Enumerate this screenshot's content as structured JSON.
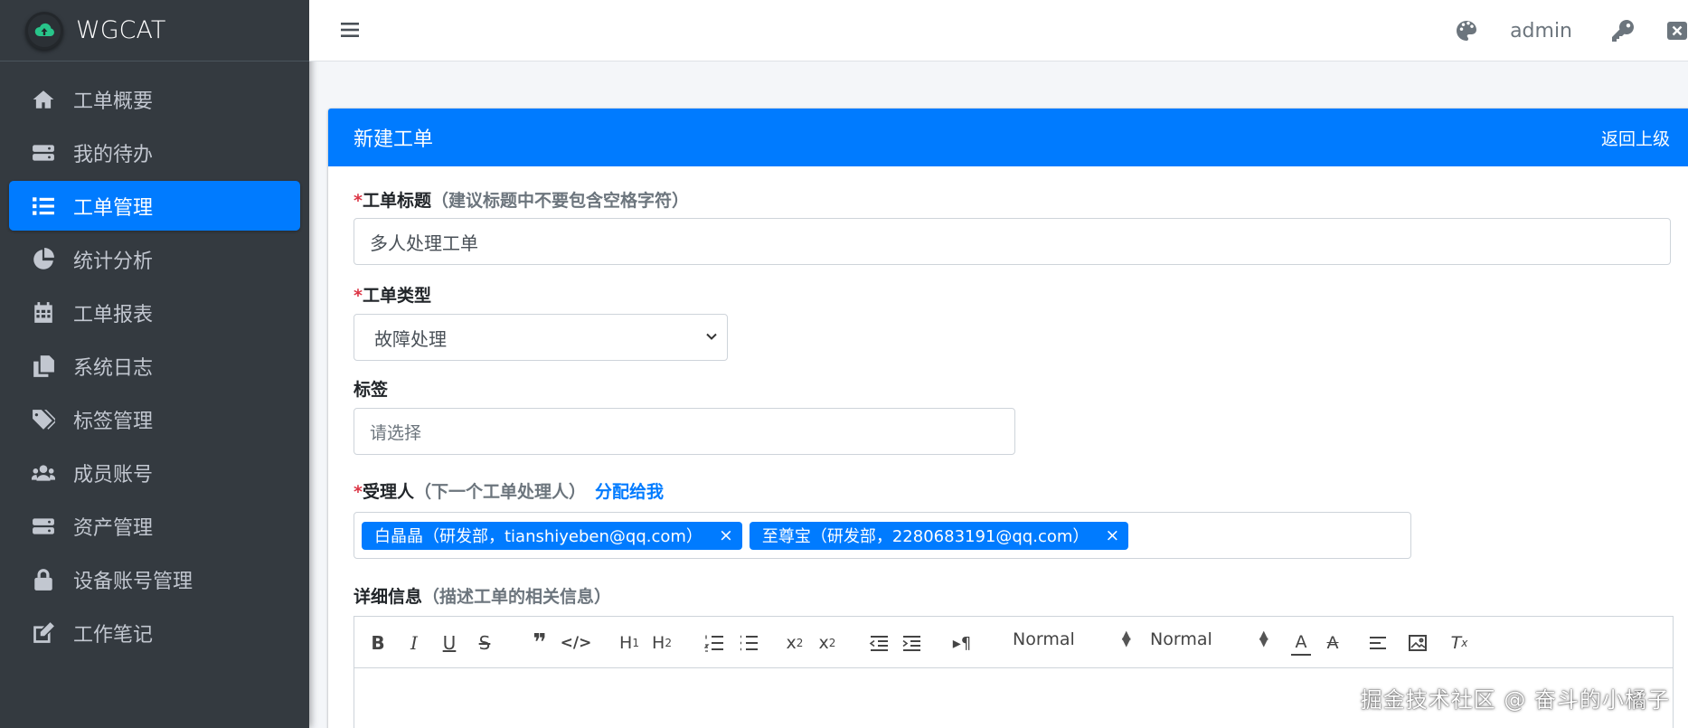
{
  "brand": {
    "name": "WGCAT"
  },
  "sidebar": {
    "items": [
      {
        "label": "工单概要",
        "icon": "home-icon"
      },
      {
        "label": "我的待办",
        "icon": "server-icon"
      },
      {
        "label": "工单管理",
        "icon": "list-icon",
        "active": true
      },
      {
        "label": "统计分析",
        "icon": "pie-chart-icon"
      },
      {
        "label": "工单报表",
        "icon": "calendar-icon"
      },
      {
        "label": "系统日志",
        "icon": "copy-icon"
      },
      {
        "label": "标签管理",
        "icon": "tags-icon"
      },
      {
        "label": "成员账号",
        "icon": "users-icon"
      },
      {
        "label": "资产管理",
        "icon": "server-icon"
      },
      {
        "label": "设备账号管理",
        "icon": "lock-icon"
      },
      {
        "label": "工作笔记",
        "icon": "edit-icon"
      }
    ]
  },
  "topbar": {
    "username": "admin"
  },
  "card": {
    "title": "新建工单",
    "back_label": "返回上级"
  },
  "form": {
    "title_field": {
      "required_mark": "*",
      "label": "工单标题",
      "hint": "（建议标题中不要包含空格字符）",
      "value": "多人处理工单"
    },
    "type_field": {
      "required_mark": "*",
      "label": "工单类型",
      "value": "故障处理"
    },
    "tags_field": {
      "label": "标签",
      "placeholder": "请选择"
    },
    "assignee_field": {
      "required_mark": "*",
      "label": "受理人",
      "hint": "（下一个工单处理人）",
      "assign_link": "分配给我",
      "tags": [
        {
          "text": "白晶晶（研发部，tianshiyeben@qq.com）",
          "remove": "×"
        },
        {
          "text": "至尊宝（研发部，2280683191@qq.com）",
          "remove": "×"
        }
      ]
    },
    "detail_field": {
      "label": "详细信息",
      "hint": "（描述工单的相关信息）"
    }
  },
  "editor": {
    "header_picker": "Normal",
    "size_picker": "Normal"
  },
  "watermark": "掘金技术社区 @ 奋斗的小橘子",
  "colors": {
    "accent": "#007bff",
    "sidebar": "#343a40",
    "required": "#dc3545"
  }
}
